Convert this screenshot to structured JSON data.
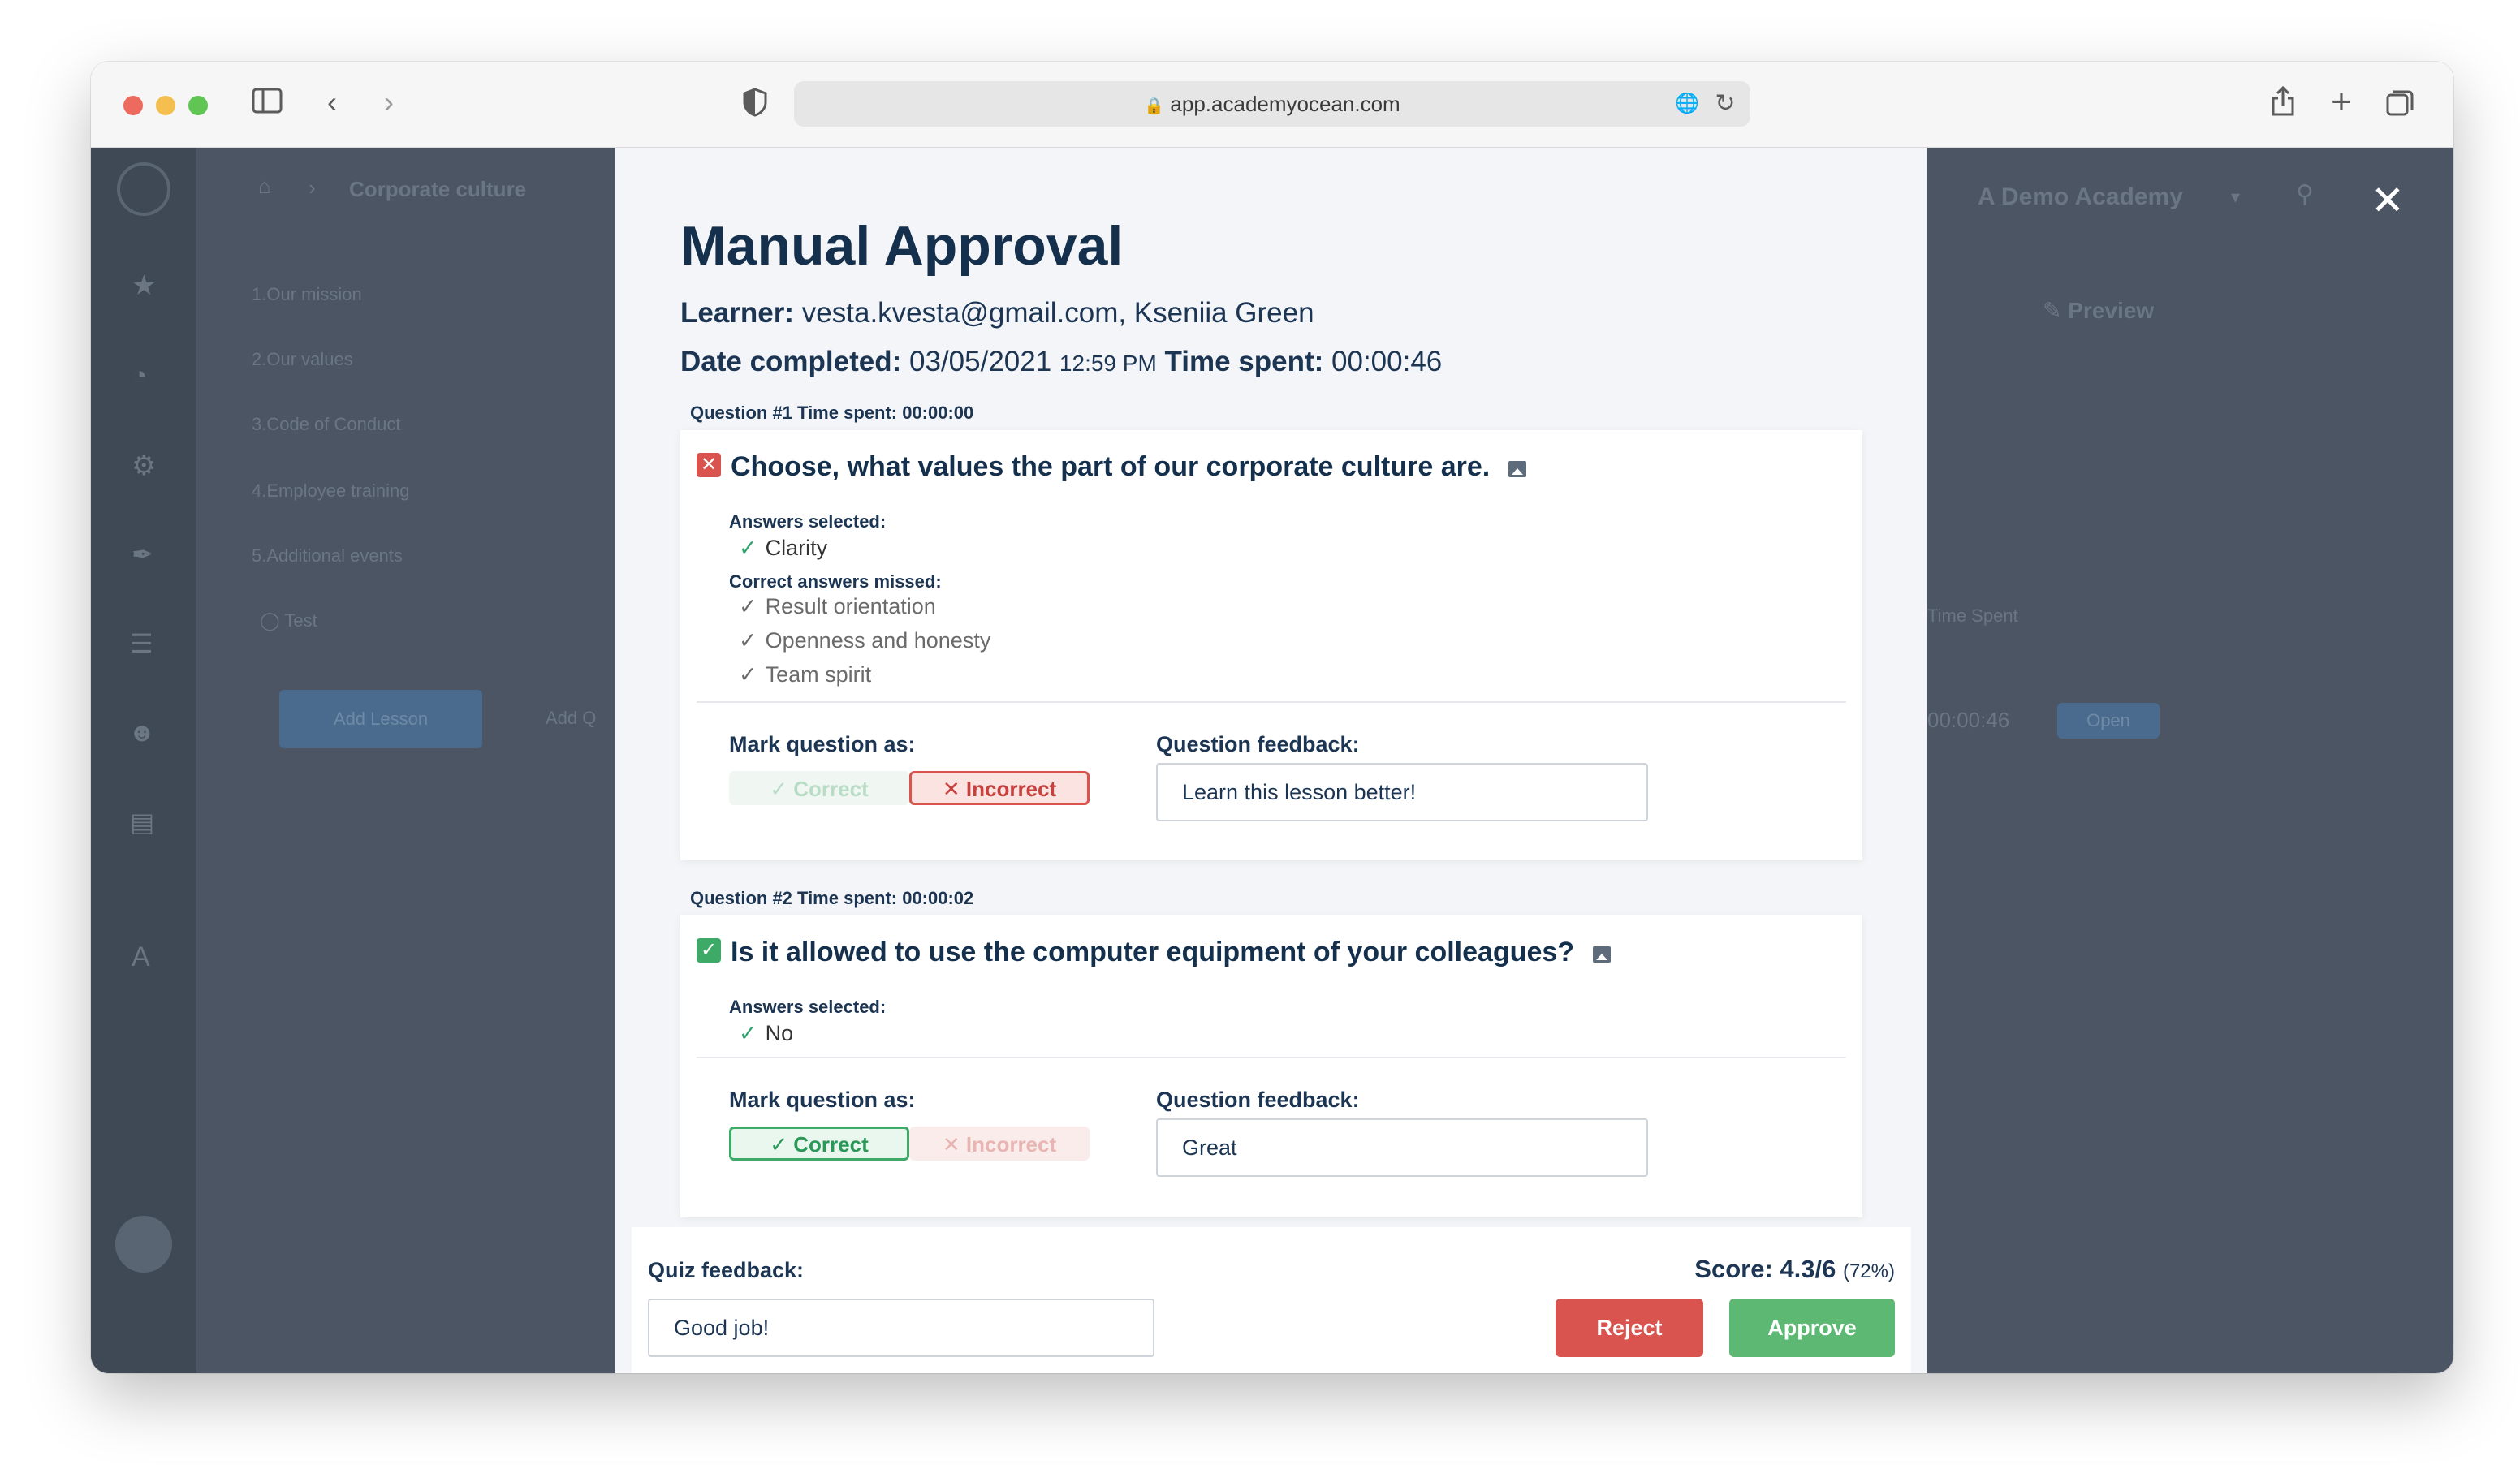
{
  "browser": {
    "url": "app.academyocean.com",
    "colors": {
      "close": "#ed6a5e",
      "minimize": "#f5bf4f",
      "maximize": "#61c554"
    }
  },
  "background_app": {
    "breadcrumb": "Corporate culture",
    "lessons": [
      "1.Our mission",
      "2.Our values",
      "3.Code of Conduct",
      "4.Employee training",
      "5.Additional events"
    ],
    "test_label": "Test",
    "add_lesson": "Add Lesson",
    "add_other": "Add Q",
    "academy_name": "Demo Academy",
    "preview": "Preview",
    "time_spent_header": "Time Spent",
    "time_value": "00:00:46",
    "open_button": "Open"
  },
  "modal": {
    "title": "Manual Approval",
    "learner_label": "Learner:",
    "learner_value": "vesta.kvesta@gmail.com, Kseniia Green",
    "date_label": "Date completed:",
    "date_value": "03/05/2021",
    "time_value": "12:59 PM",
    "time_spent_label": "Time spent:",
    "time_spent_value": "00:00:46",
    "questions": [
      {
        "header": "Question #1 Time spent: 00:00:00",
        "title": "Choose, what values the part of our corporate culture are.",
        "status": "incorrect",
        "answers_selected_label": "Answers selected:",
        "answers_selected": [
          "Clarity"
        ],
        "missed_label": "Correct answers missed:",
        "missed": [
          "Result orientation",
          "Openness and honesty",
          "Team spirit"
        ],
        "mark_label": "Mark question as:",
        "correct_label": "Correct",
        "incorrect_label": "Incorrect",
        "feedback_label": "Question feedback:",
        "feedback_value": "Learn this lesson better!"
      },
      {
        "header": "Question #2 Time spent: 00:00:02",
        "title": "Is it allowed to use the computer equipment of your colleagues?",
        "status": "correct",
        "answers_selected_label": "Answers selected:",
        "answers_selected": [
          "No"
        ],
        "mark_label": "Mark question as:",
        "correct_label": "Correct",
        "incorrect_label": "Incorrect",
        "feedback_label": "Question feedback:",
        "feedback_value": "Great"
      }
    ],
    "footer": {
      "quiz_feedback_label": "Quiz feedback:",
      "quiz_feedback_value": "Good job!",
      "score_label": "Score: 4.3/6",
      "score_pct": "(72%)",
      "reject_label": "Reject",
      "approve_label": "Approve"
    }
  },
  "colors": {
    "reject": "#d9534f",
    "approve": "#5cb873",
    "incorrect_icon": "#d9534f",
    "correct_icon": "#3dab67"
  }
}
